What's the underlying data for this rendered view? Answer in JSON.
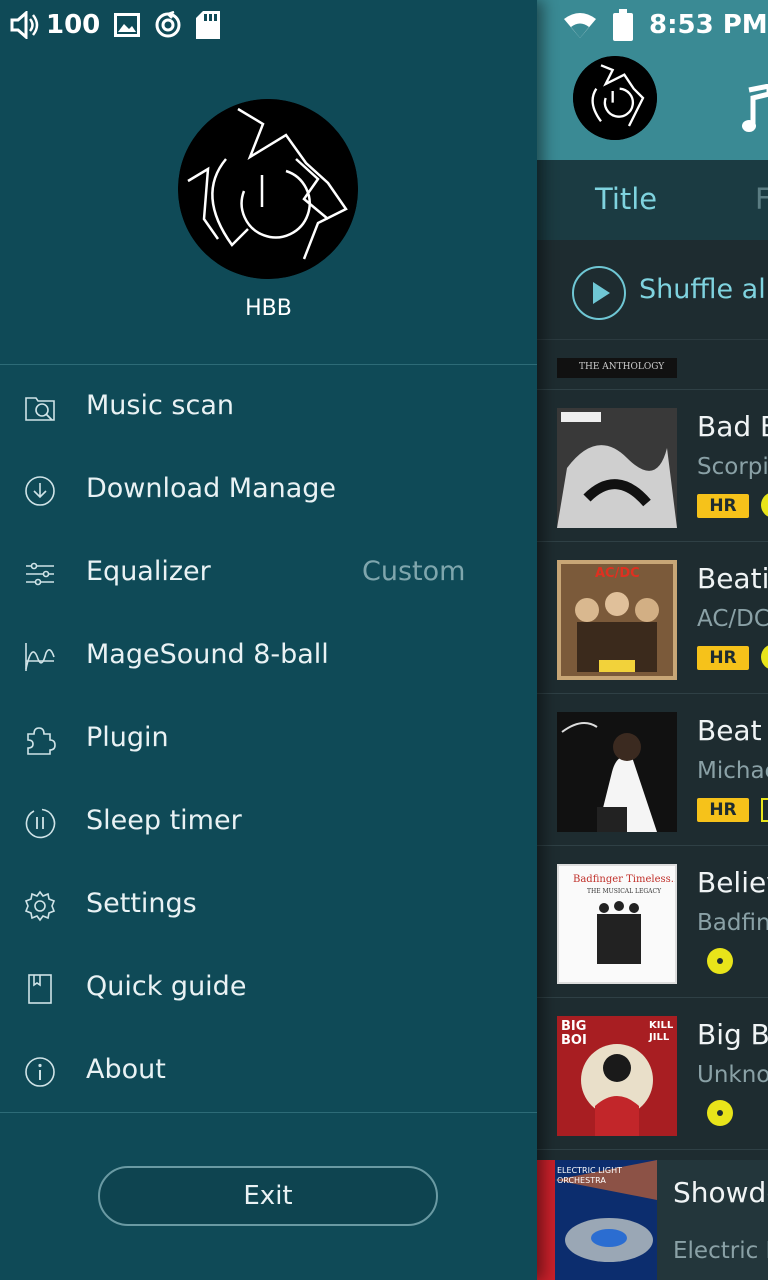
{
  "status": {
    "volume": "100",
    "time": "8:53 PM"
  },
  "profile": {
    "name": "HBB"
  },
  "menu": [
    {
      "id": "music-scan",
      "label": "Music scan",
      "icon": "folder-search-icon"
    },
    {
      "id": "download-manage",
      "label": "Download Manage",
      "icon": "download-icon"
    },
    {
      "id": "equalizer",
      "label": "Equalizer",
      "value": "Custom",
      "icon": "equalizer-sliders-icon"
    },
    {
      "id": "magesound",
      "label": "MageSound 8-ball",
      "icon": "waveform-icon"
    },
    {
      "id": "plugin",
      "label": "Plugin",
      "icon": "puzzle-icon"
    },
    {
      "id": "sleep-timer",
      "label": "Sleep timer",
      "icon": "sleep-timer-icon"
    },
    {
      "id": "settings",
      "label": "Settings",
      "icon": "gear-icon"
    },
    {
      "id": "quick-guide",
      "label": "Quick guide",
      "icon": "book-icon"
    },
    {
      "id": "about",
      "label": "About",
      "icon": "info-icon"
    }
  ],
  "exit_label": "Exit",
  "main": {
    "tabs": [
      "Title",
      "F"
    ],
    "shuffle_label": "Shuffle all",
    "partial_row_thumb_text": "THE ANTHOLOGY",
    "songs": [
      {
        "title": "Bad B",
        "artist": "Scorpic",
        "hr": "HR"
      },
      {
        "title": "Beatir",
        "artist": "AC/DC",
        "hr": "HR",
        "thumb_text": "AC/DC"
      },
      {
        "title": "Beat",
        "artist": "Michae",
        "hr": "HR"
      },
      {
        "title": "Believ",
        "artist": "Badfing",
        "thumb_text": "Badfinger Timeless...",
        "thumb_sub": "THE MUSICAL LEGACY"
      },
      {
        "title": "Big Bo",
        "artist": "Unknov",
        "thumb_text": "BIG BOI",
        "thumb_sub": "KILL JILL"
      }
    ],
    "now_playing": {
      "title": "Showdo",
      "artist": "Electric L",
      "thumb_text": "ELECTRIC LIGHT ORCHESTRA"
    }
  },
  "colors": {
    "drawer_bg": "#0f4a57",
    "accent": "#7fd3df",
    "hr_badge": "#f6c21a",
    "disc": "#e8e41a"
  }
}
